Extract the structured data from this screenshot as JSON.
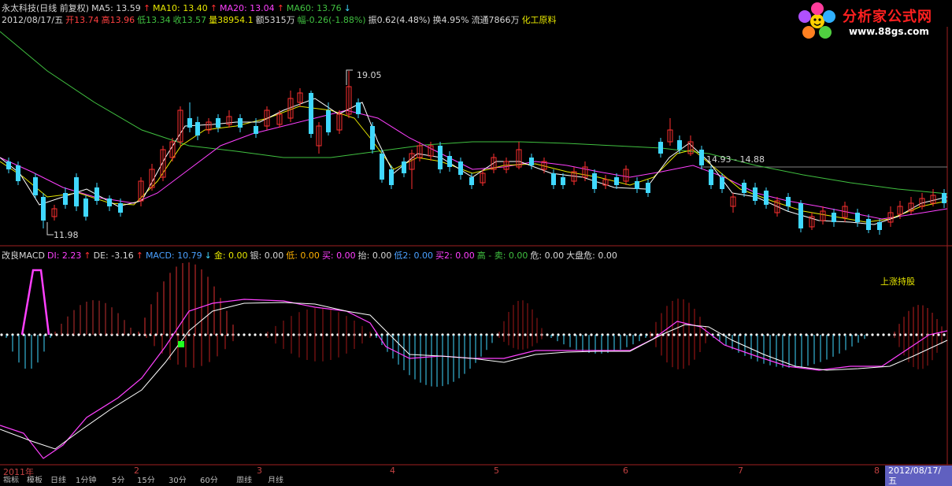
{
  "header1": {
    "stock_name": "永太科技(日线 前复权)",
    "ma5_label": "MA5: 13.59",
    "ma10_label": "MA10: 13.40",
    "ma20_label": "MA20: 13.04",
    "ma60_label": "MA60: 13.76"
  },
  "header2": {
    "date": "2012/08/17/五",
    "open": "开13.74",
    "high": "高13.96",
    "low": "低13.34",
    "close": "收13.57",
    "volume": "量38954.1",
    "amount": "额5315万",
    "change": "幅-0.26(-1.88%)",
    "amplitude": "振0.62(4.48%)",
    "turnover": "换4.95%",
    "float": "流通7866万",
    "sector": "化工原料"
  },
  "logo": {
    "title": "分析家公式网",
    "url": "www.88gs.com"
  },
  "annotations": {
    "high_price": "19.05",
    "low_price": "11.98",
    "range": "14.93 - 14.88"
  },
  "macd_header": {
    "name": "改良MACD",
    "di": "DI: 2.23",
    "de": "DE: -3.16",
    "macd": "MACD: 10.79",
    "gold": "金: 0.00",
    "silver": "银: 0.00",
    "low": "低: 0.00",
    "buy": "买: 0.00",
    "lift": "抬: 0.00",
    "low2": "低2: 0.00",
    "buy2": "买2: 0.00",
    "high_sell": "高 - 卖: 0.00",
    "danger": "危: 0.00",
    "market_danger": "大盘危: 0.00"
  },
  "signal_text": "上涨持股",
  "axis": {
    "ticks": [
      "2011年",
      "2",
      "3",
      "4",
      "5",
      "6",
      "7",
      "8"
    ],
    "current_date": "2012/08/17/五"
  },
  "bottom_tabs": [
    "指标",
    "模板",
    "日线",
    "1分钟",
    "5分",
    "15分",
    "30分",
    "60分",
    "周线",
    "月线"
  ],
  "colors": {
    "up": "#ff3030",
    "down": "#40d8ff",
    "ma5": "#ffffff",
    "ma10": "#e6e600",
    "ma20": "#ff40ff",
    "ma60": "#40c040"
  }
}
